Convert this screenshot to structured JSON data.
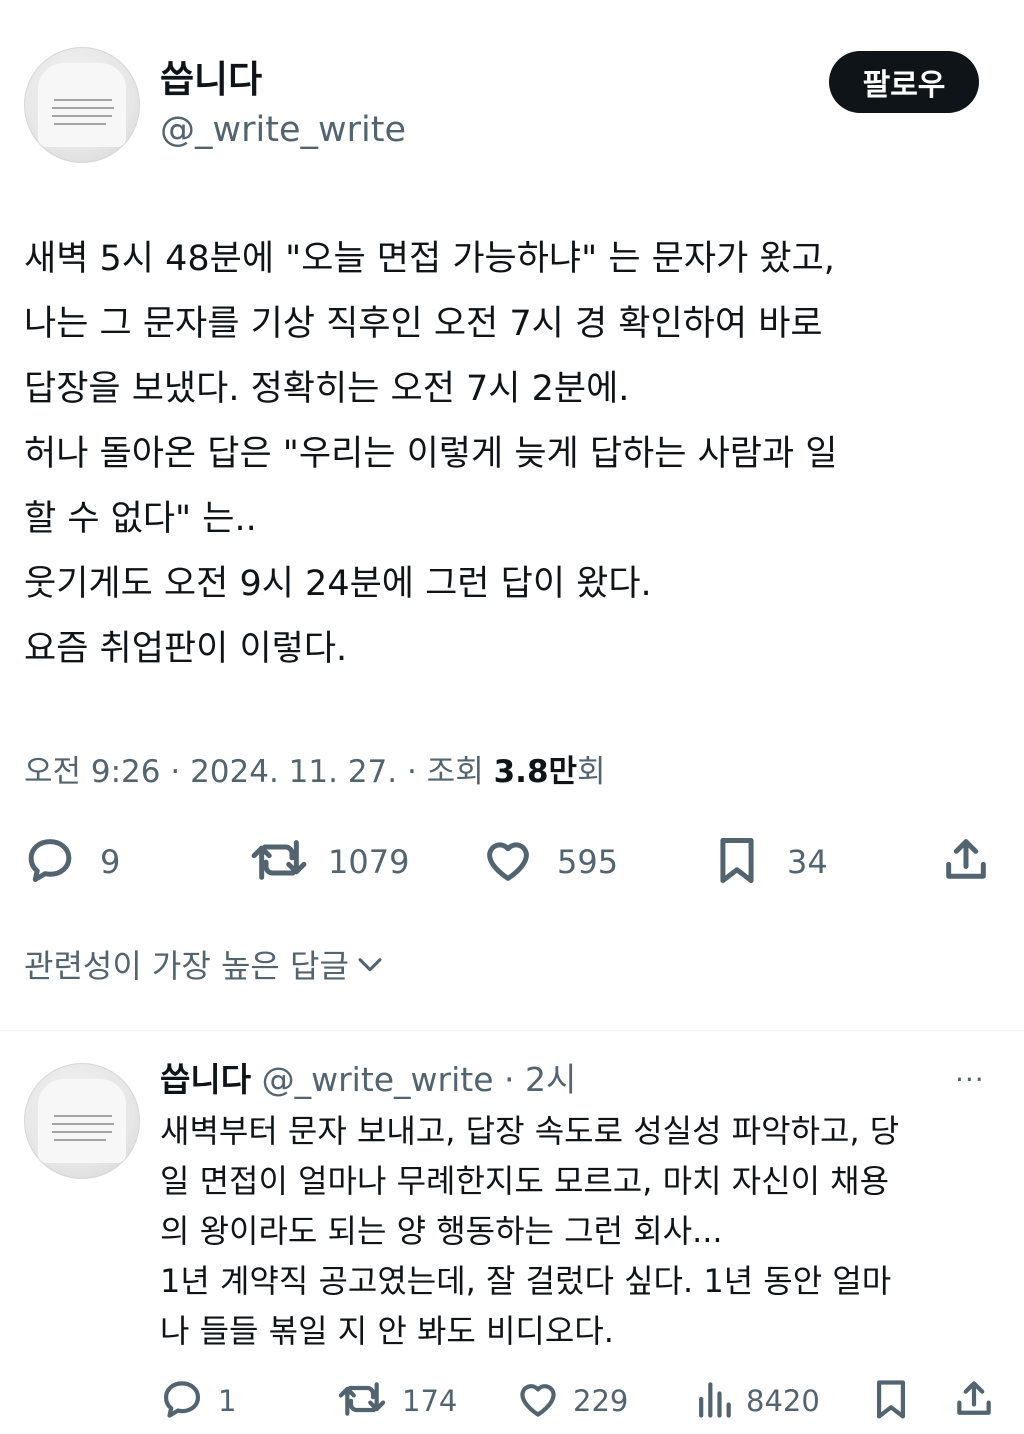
{
  "tweet": {
    "author_name": "씁니다",
    "author_handle": "@_write_write",
    "follow_label": "팔로우",
    "lines": [
      "새벽 5시 48분에 \"오늘 면접 가능하냐\" 는 문자가 왔고,",
      "나는 그 문자를 기상 직후인 오전 7시 경 확인하여 바로",
      "답장을 보냈다. 정확히는 오전 7시 2분에.",
      "허나 돌아온 답은 \"우리는 이렇게 늦게 답하는 사람과 일",
      "할 수 없다\" 는..",
      "웃기게도 오전 9시 24분에 그런 답이 왔다.",
      "요즘 취업판이 이렇다."
    ],
    "timestamp": "오전 9:26 · 2024. 11. 27. · 조회 ",
    "views_value": "3.8만",
    "views_suffix": "회",
    "actions": {
      "replies": "9",
      "retweets": "1079",
      "likes": "595",
      "bookmarks": "34"
    }
  },
  "sort_label": "관련성이 가장 높은 답글",
  "reply": {
    "author_name": "씁니다",
    "author_handle": "@_write_write",
    "time": " · 2시",
    "more_label": "···",
    "lines": [
      "새벽부터 문자 보내고, 답장 속도로 성실성 파악하고, 당",
      "일 면접이 얼마나 무례한지도 모르고, 마치 자신이 채용",
      "의 왕이라도 되는 양 행동하는 그런 회사...",
      "1년 계약직 공고였는데, 잘 걸렀다 싶다. 1년 동안 얼마",
      "나 들들 볶일 지 안 봐도 비디오다."
    ],
    "actions": {
      "replies": "1",
      "retweets": "174",
      "likes": "229",
      "views": "8420"
    }
  },
  "icons": {
    "reply": "reply-icon",
    "retweet": "retweet-icon",
    "like": "heart-icon",
    "bookmark": "bookmark-icon",
    "share": "share-icon",
    "views": "views-icon",
    "chevron": "chevron-down-icon"
  },
  "colors": {
    "text": "#0f1419",
    "secondary": "#536471",
    "button_bg": "#0f1419",
    "divider": "#eff3f4"
  }
}
